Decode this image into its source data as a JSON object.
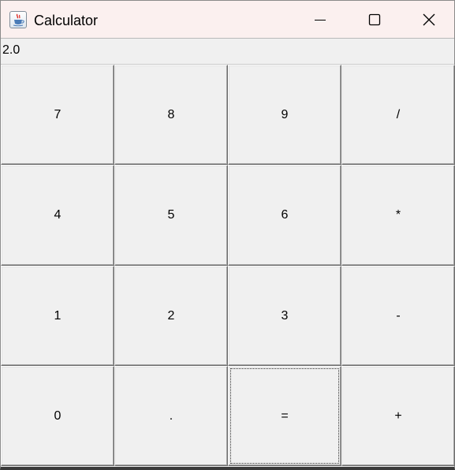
{
  "window": {
    "title": "Calculator",
    "icon": "java-app-icon",
    "controls": {
      "minimize": "minimize-icon",
      "maximize": "maximize-icon",
      "close": "close-icon"
    }
  },
  "display": {
    "value": "2.0"
  },
  "keypad": {
    "rows": [
      [
        "7",
        "8",
        "9",
        "/"
      ],
      [
        "4",
        "5",
        "6",
        "*"
      ],
      [
        "1",
        "2",
        "3",
        "-"
      ],
      [
        "0",
        ".",
        "=",
        "+"
      ]
    ],
    "focused_key": "="
  }
}
